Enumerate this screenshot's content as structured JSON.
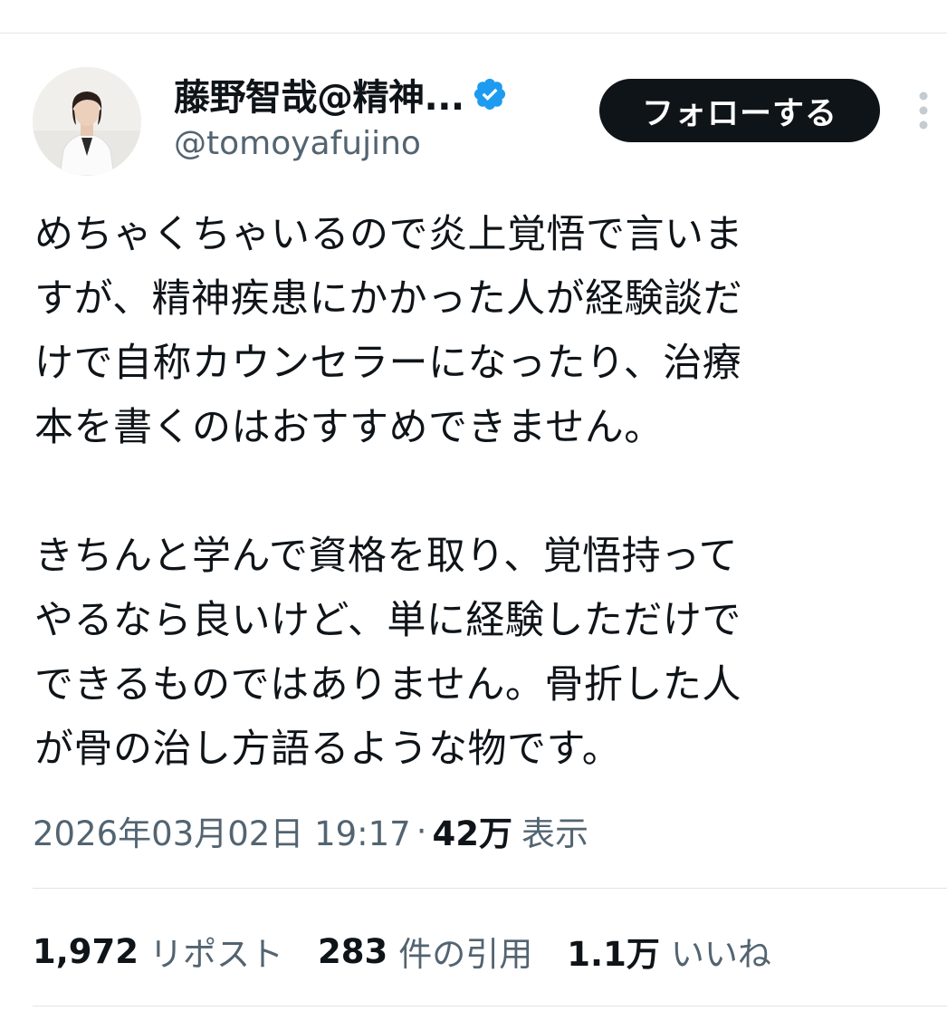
{
  "author": {
    "display_name": "藤野智哉@精神...",
    "handle": "@tomoyafujino",
    "verified_icon": "verified-badge-icon",
    "avatar_icon": "profile-photo",
    "follow_label": "フォローする"
  },
  "tweet": {
    "paragraphs": [
      [
        "めちゃくちゃいるので炎上覚悟で言いま",
        "すが、精神疾患にかかった人が経験談だ",
        "けで自称カウンセラーになったり、治療",
        "本を書くのはおすすめできません。"
      ],
      [
        "きちんと学んで資格を取り、覚悟持って",
        "やるなら良いけど、単に経験しただけで",
        "できるものではありません。骨折した人",
        "が骨の治し方語るような物です。"
      ]
    ]
  },
  "meta": {
    "timestamp": "2026年03月02日 19:17",
    "separator": "·",
    "views_count": "42万",
    "views_label": "表示"
  },
  "stats": {
    "reposts_count": "1,972",
    "reposts_label": "リポスト",
    "quotes_count": "283",
    "quotes_label": "件の引用",
    "likes_count": "1.1万",
    "likes_label": "いいね"
  },
  "colors": {
    "text_primary": "#0f1419",
    "text_secondary": "#536471",
    "verified_blue": "#1d9bf0",
    "follow_bg": "#0f1419"
  }
}
